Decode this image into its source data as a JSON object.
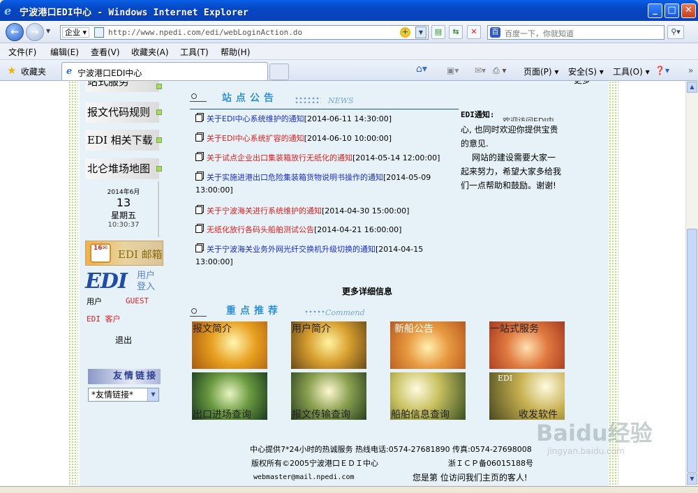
{
  "window": {
    "title": "宁波港口EDI中心 - Windows Internet Explorer"
  },
  "address": {
    "encoding": "企业",
    "url": "http://www.npedi.com/edi/webLoginAction.do"
  },
  "search": {
    "placeholder": "百度一下，你就知道"
  },
  "menu": [
    "文件(F)",
    "编辑(E)",
    "查看(V)",
    "收藏夹(A)",
    "工具(T)",
    "帮助(H)"
  ],
  "favbar": {
    "label": "收藏夹",
    "tab_title": "宁波港口EDI中心"
  },
  "tools": {
    "page": "页面(P)",
    "safety": "安全(S)",
    "tools": "工具(O)"
  },
  "sidebar": {
    "top_partial": "站式服务",
    "links": [
      "报文代码规则",
      "EDI 相关下载",
      "北仑堆场地图"
    ],
    "calendar": {
      "year_month": "2014年6月",
      "day": "13",
      "weekday": "星期五",
      "time": "10:30:37"
    },
    "mail_label": "EDI 邮箱",
    "login_label_1": "用户",
    "login_label_2": "登入",
    "user_label": "用户",
    "user_value": "GUEST",
    "user_type": "EDI 客户",
    "logout": "退出",
    "friend_banner": "友情链接",
    "friend_select": "*友情链接*"
  },
  "notices": {
    "title": "站点公告",
    "title_sub": "NEWS",
    "items": [
      {
        "text": "关于EDI中心系统维护的通知",
        "date": "[2014-06-11 14:30:00]",
        "color": "blue"
      },
      {
        "text": "关于EDI中心系统扩容的通知",
        "date": "[2014-06-10 10:00:00]",
        "color": "red"
      },
      {
        "text": "关于试点企业出口集装箱放行无纸化的通知",
        "date": "[2014-05-14 12:00:00]",
        "color": "red"
      },
      {
        "text": "关于实施进港出口危险集装箱货物说明书操作的通知",
        "date": "[2014-05-09 13:00:00]",
        "color": "blue"
      },
      {
        "text": "关于宁波海关进行系统维护的通知",
        "date": "[2014-04-30 15:00:00]",
        "color": "red"
      },
      {
        "text": "无纸化放行各码头船舶测试公告",
        "date": "[2014-04-21 16:00:00]",
        "color": "red"
      },
      {
        "text": "关于宁波海关业务外网光纤交换机升级切换的通知",
        "date": "[2014-04-15 13:00:00]",
        "color": "blue"
      }
    ],
    "more": "更多详细信息"
  },
  "recommend": {
    "title": "重点推荐",
    "title_sub": "Commend",
    "tiles": [
      "报文简介",
      "用户简介",
      "新船公告",
      "一站式服务",
      "出口进场查询",
      "报文传输查询",
      "船舶信息查询",
      "EDI",
      "收发软件"
    ]
  },
  "edi_notice": {
    "title": "EDI通知:",
    "partial_top": "欢迎访问EDI中",
    "p1": "心, 也同时欢迎你提供宝贵的意见.",
    "p2": "网站的建设需要大家一起来努力，希望大家多给我们一点帮助和鼓励。谢谢!",
    "top_cut": "更多"
  },
  "footer": {
    "line1": "中心提供7*24小时的热诚服务  热线电话:0574-27681890  传真:0574-27698008",
    "copyright": "版权所有©2005宁波港口ＥＤＩ中心",
    "icp": "浙ＩＣＰ备06015188号",
    "email": "webmaster@mail.npedi.com",
    "visitor": "您是第  位访问我们主页的客人!"
  },
  "watermark": {
    "brand": "Baidu经验",
    "url": "jingyan.baidu.com"
  }
}
